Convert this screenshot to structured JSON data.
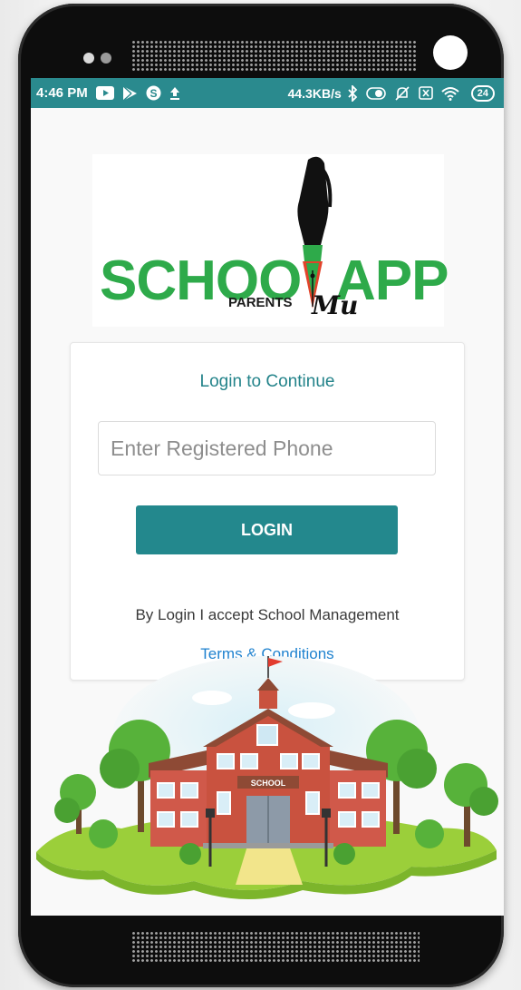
{
  "status_bar": {
    "time": "4:46 PM",
    "network_speed": "44.3KB/s",
    "battery": "24",
    "background_color": "#2a8a8e",
    "left_icons": [
      "youtube-icon",
      "play-store-icon",
      "skype-icon",
      "upload-icon"
    ],
    "right_icons": [
      "bluetooth-icon",
      "toggle-icon",
      "muted-bell-icon",
      "sim-x-icon",
      "wifi-icon",
      "battery-icon"
    ]
  },
  "logo": {
    "word_left": "SCHOO",
    "word_right": "APP",
    "sub": "PARENTS",
    "signature": "Mu",
    "brand_green": "#2eaa4a"
  },
  "login_card": {
    "title": "Login  to Continue",
    "phone_placeholder": "Enter Registered Phone",
    "login_button": "LOGIN",
    "accept_text": "By Login I accept School Management",
    "terms_link": "Terms & Conditions",
    "accent_color": "#23888d",
    "link_color": "#1f82cf"
  },
  "illustration": {
    "school_sign": "SCHOOL"
  }
}
